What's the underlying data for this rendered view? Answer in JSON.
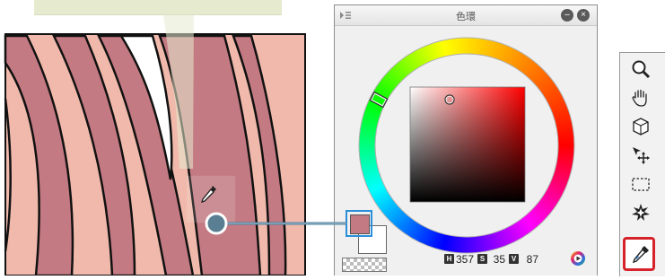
{
  "color_panel": {
    "title": "色環",
    "hue_letter": "H",
    "hue_value": "357",
    "saturation_letter": "S",
    "saturation_value": "35",
    "value_letter": "V",
    "value_value": "87",
    "main_color": "#c47a82",
    "sub_color": "#ffffff"
  },
  "tool_palette": {
    "tools": [
      {
        "name": "zoom-tool",
        "icon": "magnifier-icon"
      },
      {
        "name": "move-tool",
        "icon": "hand-icon"
      },
      {
        "name": "operation-tool",
        "icon": "object-cube-icon"
      },
      {
        "name": "layer-move-tool",
        "icon": "move-arrows-icon"
      },
      {
        "name": "selection-tool",
        "icon": "dashed-rectangle-icon"
      },
      {
        "name": "auto-select-tool",
        "icon": "magic-wand-icon"
      },
      {
        "name": "eyedropper-tool",
        "icon": "eyedropper-icon",
        "selected": true
      }
    ],
    "highlight_color": "#d6232b"
  },
  "canvas": {
    "skin_color": "#f0b9ab",
    "hair_color": "#c47a82",
    "cursor": "eyedropper-icon"
  }
}
